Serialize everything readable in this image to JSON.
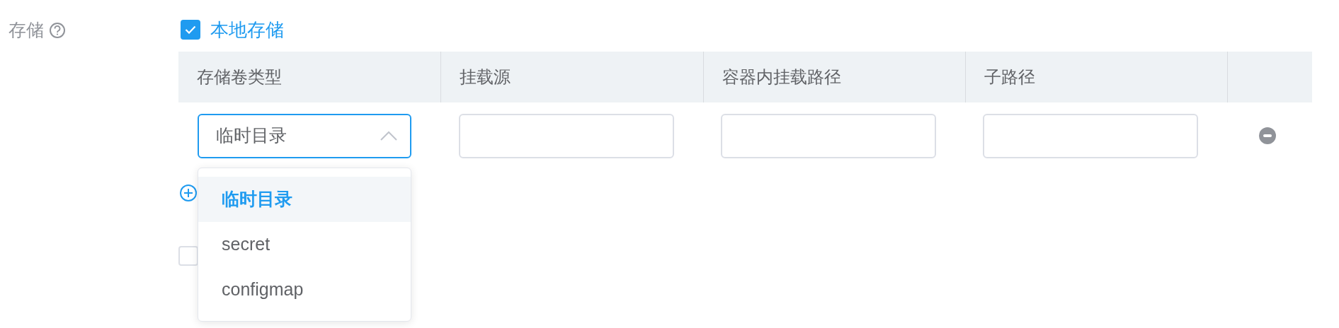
{
  "field": {
    "label": "存储"
  },
  "local_storage": {
    "label": "本地存储",
    "checked": true
  },
  "table": {
    "columns": [
      "存储卷类型",
      "挂载源",
      "容器内挂载路径",
      "子路径"
    ],
    "rows": [
      {
        "volume_type": "临时目录",
        "expanded": true
      }
    ]
  },
  "dropdown": {
    "options": [
      {
        "label": "临时目录",
        "selected": true
      },
      {
        "label": "secret",
        "selected": false
      },
      {
        "label": "configmap",
        "selected": false
      }
    ]
  },
  "second_checkbox": {
    "checked": false
  }
}
